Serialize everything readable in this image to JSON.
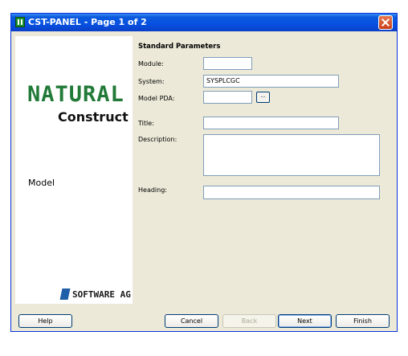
{
  "window": {
    "title": "CST-PANEL - Page 1 of 2"
  },
  "left_panel": {
    "logo_line1": "NATURAL",
    "logo_line2": "Construct",
    "model_text": "Model",
    "vendor": "SOFTWARE AG"
  },
  "section": {
    "title": "Standard Parameters"
  },
  "fields": {
    "module": {
      "label": "Module:",
      "value": ""
    },
    "system": {
      "label": "System:",
      "value": "SYSPLCGC"
    },
    "model_pda": {
      "label": "Model PDA:",
      "value": "",
      "browse_label": "..."
    },
    "title": {
      "label": "Title:",
      "value": ""
    },
    "description": {
      "label": "Description:",
      "value": ""
    },
    "heading": {
      "label": "Heading:",
      "value": ""
    }
  },
  "buttons": {
    "help": "Help",
    "cancel": "Cancel",
    "back": "Back",
    "next": "Next",
    "finish": "Finish"
  },
  "icons": {
    "app": "natural-app-icon",
    "close": "close-icon",
    "vendor": "software-ag-logo-icon"
  },
  "colors": {
    "titlebar": "#0a5ade",
    "logo_green": "#217a38",
    "vendor_blue": "#1f5ea8",
    "dialog_bg": "#ece9d8"
  }
}
